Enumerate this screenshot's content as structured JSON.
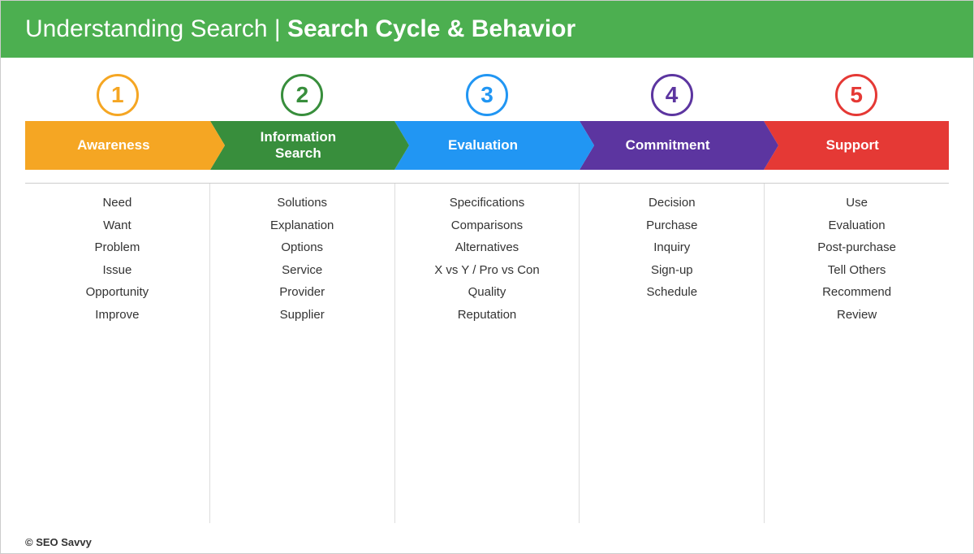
{
  "header": {
    "text_normal": "Understanding Search | ",
    "text_bold": "Search Cycle & Behavior"
  },
  "steps": [
    {
      "number": "1",
      "label": "Awareness",
      "color_class": "step-1",
      "circle_color": "#f5a623",
      "keywords": [
        "Need",
        "Want",
        "Problem",
        "Issue",
        "Opportunity",
        "Improve"
      ]
    },
    {
      "number": "2",
      "label": "Information\nSearch",
      "color_class": "step-2",
      "circle_color": "#388e3c",
      "keywords": [
        "Solutions",
        "Explanation",
        "Options",
        "Service",
        "Provider",
        "Supplier"
      ]
    },
    {
      "number": "3",
      "label": "Evaluation",
      "color_class": "step-3",
      "circle_color": "#2196f3",
      "keywords": [
        "Specifications",
        "Comparisons",
        "Alternatives",
        "X vs Y / Pro vs Con",
        "Quality",
        "Reputation"
      ]
    },
    {
      "number": "4",
      "label": "Commitment",
      "color_class": "step-4",
      "circle_color": "#5c35a0",
      "keywords": [
        "Decision",
        "Purchase",
        "Inquiry",
        "Sign-up",
        "Schedule"
      ]
    },
    {
      "number": "5",
      "label": "Support",
      "color_class": "step-5",
      "circle_color": "#e53935",
      "keywords": [
        "Use",
        "Evaluation",
        "Post-purchase",
        "Tell Others",
        "Recommend",
        "Review"
      ]
    }
  ],
  "footer": {
    "text": "© SEO Savvy"
  }
}
